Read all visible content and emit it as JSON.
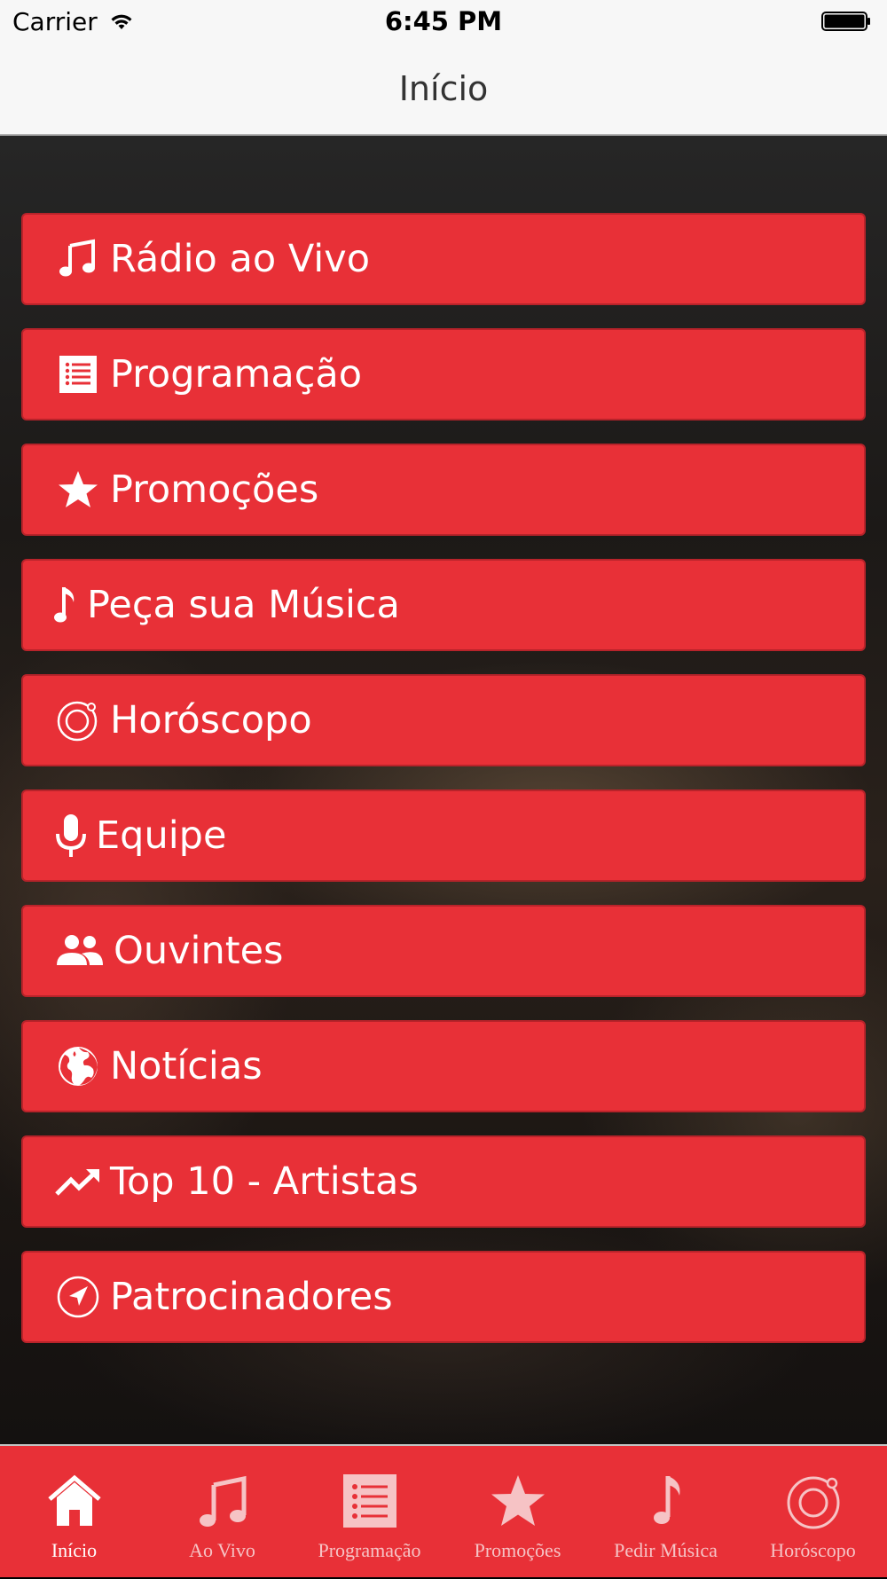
{
  "status_bar": {
    "carrier": "Carrier",
    "time": "6:45 PM"
  },
  "nav": {
    "title": "Início"
  },
  "colors": {
    "accent": "#e83037",
    "tab_inactive": "#f6c3c5",
    "tab_active": "#ffffff"
  },
  "menu": [
    {
      "label": "Rádio ao Vivo",
      "icon": "music-notes-icon"
    },
    {
      "label": "Programação",
      "icon": "list-icon"
    },
    {
      "label": "Promoções",
      "icon": "star-icon"
    },
    {
      "label": "Peça sua Música",
      "icon": "music-note-icon"
    },
    {
      "label": "Horóscopo",
      "icon": "zodiac-ring-icon"
    },
    {
      "label": "Equipe",
      "icon": "microphone-icon"
    },
    {
      "label": "Ouvintes",
      "icon": "people-icon"
    },
    {
      "label": "Notícias",
      "icon": "globe-icon"
    },
    {
      "label": "Top 10 - Artistas",
      "icon": "trending-up-icon"
    },
    {
      "label": "Patrocinadores",
      "icon": "navigation-arrow-icon"
    }
  ],
  "tabs": [
    {
      "label": "Início",
      "icon": "home-icon",
      "active": true
    },
    {
      "label": "Ao Vivo",
      "icon": "music-notes-icon",
      "active": false
    },
    {
      "label": "Programação",
      "icon": "list-icon",
      "active": false
    },
    {
      "label": "Promoções",
      "icon": "star-icon",
      "active": false
    },
    {
      "label": "Pedir Música",
      "icon": "music-note-icon",
      "active": false
    },
    {
      "label": "Horóscopo",
      "icon": "zodiac-ring-icon",
      "active": false
    }
  ]
}
